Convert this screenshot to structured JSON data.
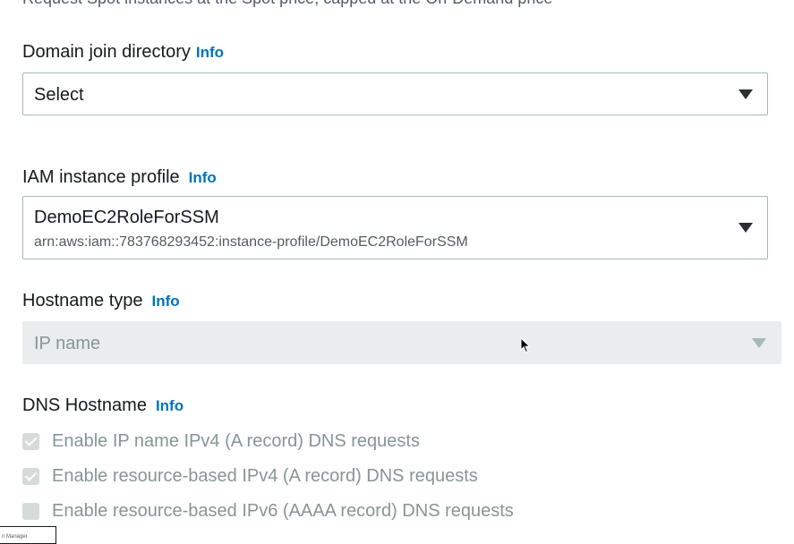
{
  "cut_off_text": "Request Spot instances at the Spot price, capped at the On-Demand price",
  "domain_join": {
    "label": "Domain join directory",
    "info": "Info",
    "select_value": "Select"
  },
  "iam_profile": {
    "label": "IAM instance profile",
    "info": "Info",
    "select_value": "DemoEC2RoleForSSM",
    "select_sub": "arn:aws:iam::783768293452:instance-profile/DemoEC2RoleForSSM"
  },
  "hostname_type": {
    "label": "Hostname type",
    "info": "Info",
    "select_value": "IP name",
    "disabled": true
  },
  "dns_hostname": {
    "label": "DNS Hostname",
    "info": "Info",
    "options": [
      {
        "label": "Enable IP name IPv4 (A record) DNS requests",
        "checked": true,
        "disabled": true
      },
      {
        "label": "Enable resource-based IPv4 (A record) DNS requests",
        "checked": true,
        "disabled": true
      },
      {
        "label": "Enable resource-based IPv6 (AAAA record) DNS requests",
        "checked": false,
        "disabled": true
      }
    ]
  },
  "thumbnail_text": "n Manager",
  "colors": {
    "link": "#0073bb",
    "border": "#aab7b8",
    "disabled_bg": "#eaeded",
    "disabled_text": "#879596"
  }
}
